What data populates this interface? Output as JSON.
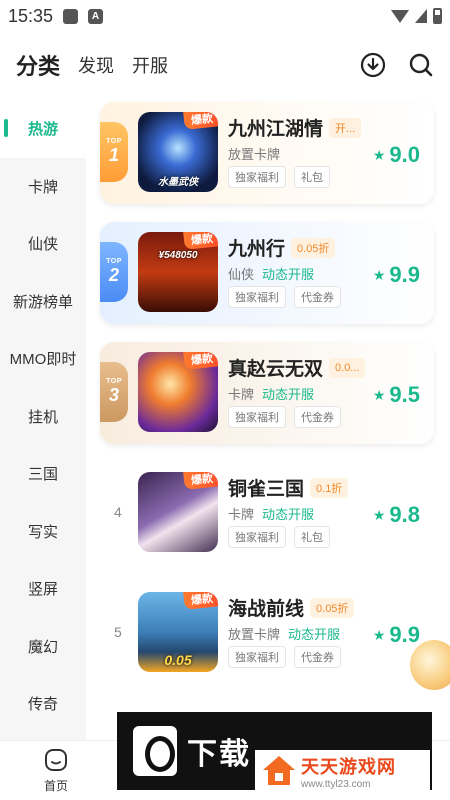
{
  "status": {
    "time": "15:35",
    "icon1": "shield",
    "icon2": "A"
  },
  "header": {
    "tabs": [
      "分类",
      "发现",
      "开服"
    ],
    "download_icon": "download-icon",
    "search_icon": "search-icon"
  },
  "sidebar": {
    "items": [
      "热游",
      "卡牌",
      "仙侠",
      "新游榜单",
      "MMO即时",
      "挂机",
      "三国",
      "写实",
      "竖屏",
      "魔幻",
      "传奇"
    ],
    "active_index": 0
  },
  "games": [
    {
      "rank": "1",
      "top": "TOP",
      "name": "九州江湖情",
      "discount": "开...",
      "category": "放置卡牌",
      "dynamic": "",
      "tags": [
        "独家福利",
        "礼包"
      ],
      "score": "9.0",
      "hot": "爆款",
      "thumb_text": "水墨武侠"
    },
    {
      "rank": "2",
      "top": "TOP",
      "name": "九州行",
      "discount": "0.05折",
      "category": "仙侠",
      "dynamic": "动态开服",
      "tags": [
        "独家福利",
        "代金券"
      ],
      "score": "9.9",
      "hot": "爆款",
      "thumb_text": "¥548050"
    },
    {
      "rank": "3",
      "top": "TOP",
      "name": "真赵云无双",
      "discount": "0.0...",
      "category": "卡牌",
      "dynamic": "动态开服",
      "tags": [
        "独家福利",
        "代金券"
      ],
      "score": "9.5",
      "hot": "爆款",
      "thumb_text": ""
    },
    {
      "rank": "4",
      "top": "",
      "name": "铜雀三国",
      "discount": "0.1折",
      "category": "卡牌",
      "dynamic": "动态开服",
      "tags": [
        "独家福利",
        "礼包"
      ],
      "score": "9.8",
      "hot": "爆款",
      "thumb_text": ""
    },
    {
      "rank": "5",
      "top": "",
      "name": "海战前线",
      "discount": "0.05折",
      "category": "放置卡牌",
      "dynamic": "动态开服",
      "tags": [
        "独家福利",
        "代金券"
      ],
      "score": "9.9",
      "hot": "爆款",
      "thumb_text": "0.05"
    }
  ],
  "bottom_nav": {
    "home_label": "首页"
  },
  "watermark": {
    "left_text": "下载",
    "site_name": "天天游戏网",
    "site_url": "www.ttyl23.com"
  },
  "colors": {
    "accent": "#1bb98d",
    "discount": "#f08a2c",
    "hot": "#ff5a2c"
  }
}
